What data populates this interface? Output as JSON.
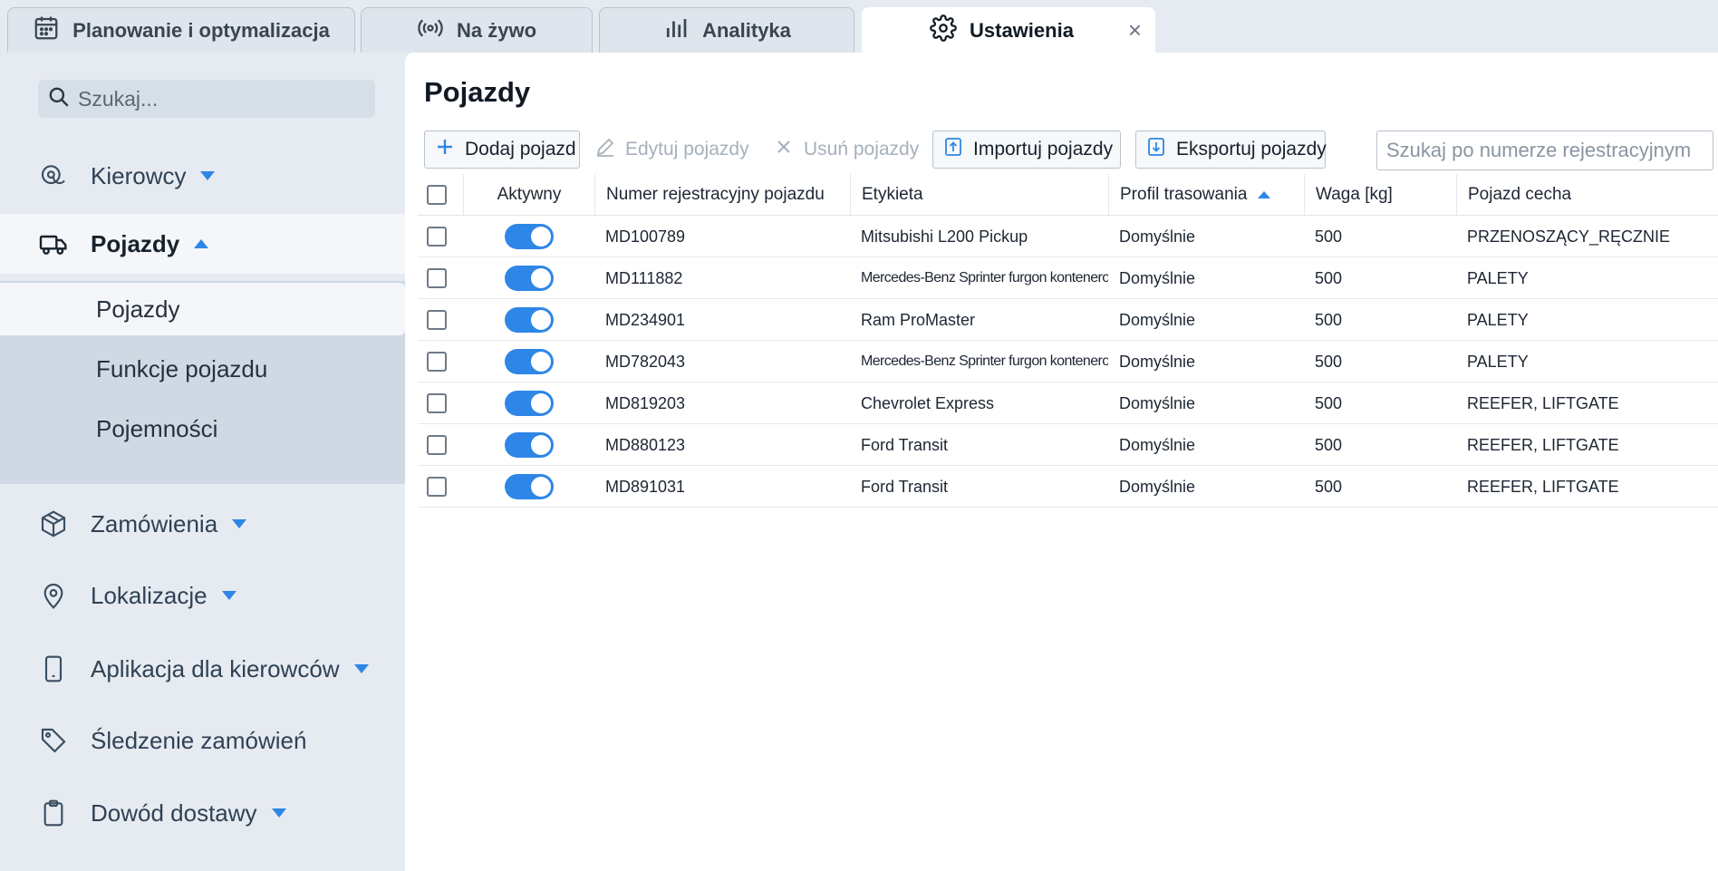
{
  "tabs": [
    {
      "label": "Planowanie i optymalizacja",
      "icon": "calendar-icon"
    },
    {
      "label": "Na żywo",
      "icon": "broadcast-icon"
    },
    {
      "label": "Analityka",
      "icon": "bar-chart-icon"
    },
    {
      "label": "Ustawienia",
      "icon": "gear-icon",
      "active": true,
      "close": "×"
    }
  ],
  "sidebar": {
    "search_placeholder": "Szukaj...",
    "items": [
      {
        "label": "Kierowcy",
        "icon": "driver-icon"
      },
      {
        "label": "Pojazdy",
        "icon": "truck-icon"
      },
      {
        "label": "Zamówienia",
        "icon": "package-icon"
      },
      {
        "label": "Lokalizacje",
        "icon": "map-pin-icon"
      },
      {
        "label": "Aplikacja dla kierowców",
        "icon": "mobile-icon"
      },
      {
        "label": "Śledzenie zamówień",
        "icon": "tag-icon"
      },
      {
        "label": "Dowód dostawy",
        "icon": "clipboard-icon"
      }
    ],
    "subitems": [
      "Pojazdy",
      "Funkcje pojazdu",
      "Pojemności"
    ]
  },
  "main": {
    "title": "Pojazdy",
    "toolbar": {
      "add": "Dodaj pojazd",
      "edit": "Edytuj pojazdy",
      "delete": "Usuń pojazdy",
      "import": "Importuj pojazdy",
      "export": "Eksportuj pojazdy",
      "search_placeholder": "Szukaj po numerze rejestracyjnym"
    },
    "table": {
      "columns": [
        "Aktywny",
        "Numer rejestracyjny pojazdu",
        "Etykieta",
        "Profil trasowania",
        "Waga [kg]",
        "Pojazd cecha"
      ],
      "rows": [
        {
          "plate": "MD100789",
          "label": "Mitsubishi L200 Pickup",
          "profile": "Domyślnie",
          "weight": "500",
          "feature": "PRZENOSZĄCY_RĘCZNIE"
        },
        {
          "plate": "MD111882",
          "label": "Mercedes-Benz Sprinter furgon kontenerowy",
          "profile": "Domyślnie",
          "weight": "500",
          "feature": "PALETY"
        },
        {
          "plate": "MD234901",
          "label": "Ram ProMaster",
          "profile": "Domyślnie",
          "weight": "500",
          "feature": "PALETY"
        },
        {
          "plate": "MD782043",
          "label": "Mercedes-Benz Sprinter furgon kontenerowy",
          "profile": "Domyślnie",
          "weight": "500",
          "feature": "PALETY"
        },
        {
          "plate": "MD819203",
          "label": "Chevrolet Express",
          "profile": "Domyślnie",
          "weight": "500",
          "feature": "REEFER, LIFTGATE"
        },
        {
          "plate": "MD880123",
          "label": "Ford Transit",
          "profile": "Domyślnie",
          "weight": "500",
          "feature": "REEFER, LIFTGATE"
        },
        {
          "plate": "MD891031",
          "label": "Ford Transit",
          "profile": "Domyślnie",
          "weight": "500",
          "feature": "REEFER, LIFTGATE"
        }
      ]
    }
  },
  "colors": {
    "accent": "#2e86e6",
    "sidebar_bg": "#e6ebf1",
    "subnav_bg": "#d0d9e3"
  }
}
